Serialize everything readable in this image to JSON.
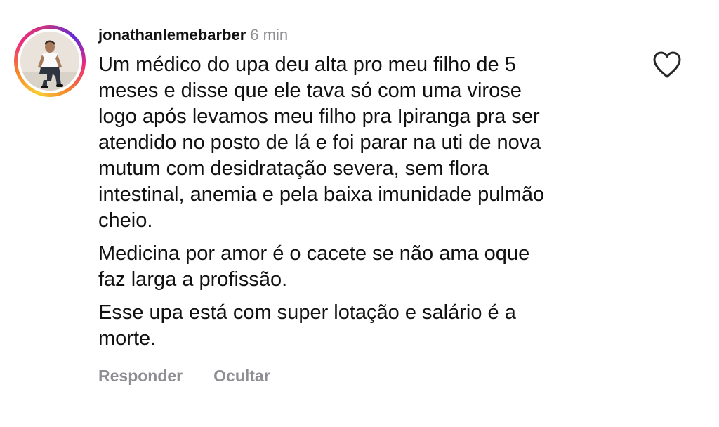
{
  "comment": {
    "username": "jonathanlemebarber",
    "time": "6 min",
    "paragraphs": [
      "Um médico do upa deu alta pro meu filho de 5\nmeses e disse que ele tava só com uma virose\nlogo após levamos  meu filho pra Ipiranga pra ser\natendido no posto de lá e foi parar na uti de nova\nmutum com desidratação severa, sem flora\nintestinal, anemia e pela baixa imunidade pulmão\ncheio.",
      "Medicina por amor é o cacete se não ama oque\nfaz larga a profissão.",
      "Esse upa está com super lotação e salário é a\nmorte."
    ],
    "actions": {
      "reply": "Responder",
      "hide": "Ocultar"
    },
    "icons": {
      "like": "heart-outline-icon",
      "avatar": "profile-photo"
    }
  },
  "colors": {
    "text": "#111111",
    "muted": "#8e8e93",
    "story_ring": [
      "#f9ce34",
      "#ee2a7b",
      "#6228d7"
    ]
  }
}
